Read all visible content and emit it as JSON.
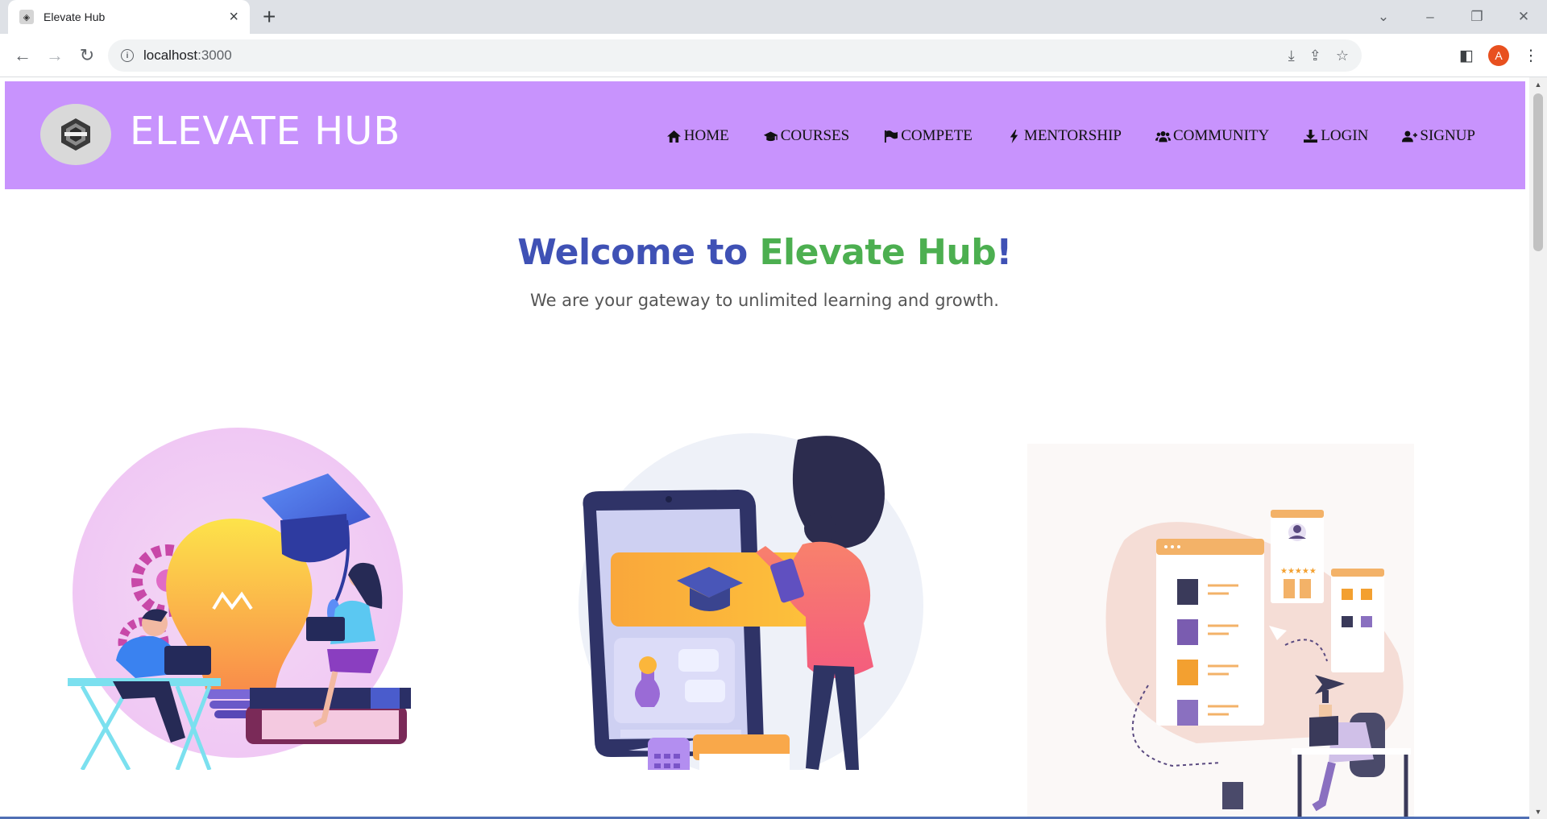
{
  "browser": {
    "tab_title": "Elevate Hub",
    "url_host": "localhost",
    "url_port": ":3000",
    "profile_initial": "A"
  },
  "site": {
    "brand": "ELEVATE HUB",
    "nav": [
      {
        "label": "HOME",
        "icon": "home-icon"
      },
      {
        "label": "COURSES",
        "icon": "graduation-cap-icon"
      },
      {
        "label": "COMPETE",
        "icon": "flag-icon"
      },
      {
        "label": "MENTORSHIP",
        "icon": "bolt-icon"
      },
      {
        "label": "COMMUNITY",
        "icon": "users-icon"
      },
      {
        "label": "LOGIN",
        "icon": "download-icon"
      },
      {
        "label": "SIGNUP",
        "icon": "user-plus-icon"
      }
    ],
    "colors": {
      "nav_bg": "#c893fd",
      "title_blue": "#3f51b5",
      "title_green": "#4caf50"
    }
  },
  "hero": {
    "title_part1": "Welcome to ",
    "title_part2": "Elevate Hub",
    "title_part3": "!",
    "subtitle": "We are your gateway to unlimited learning and growth."
  }
}
